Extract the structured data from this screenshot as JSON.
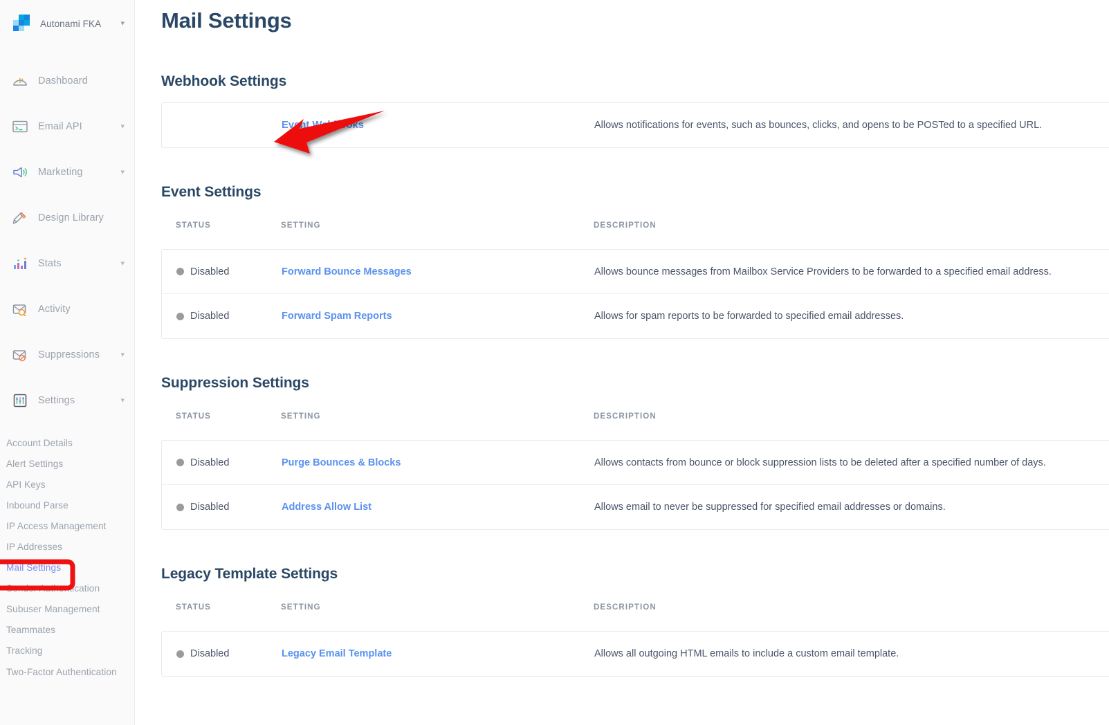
{
  "brand": {
    "name": "Autonami FKA",
    "caret": "chevron-down"
  },
  "sidebar": {
    "nav": [
      {
        "label": "Dashboard",
        "icon": "gauge-icon",
        "caret": false
      },
      {
        "label": "Email API",
        "icon": "terminal-icon",
        "caret": true
      },
      {
        "label": "Marketing",
        "icon": "megaphone-icon",
        "caret": true
      },
      {
        "label": "Design Library",
        "icon": "pencil-ruler-icon",
        "caret": false
      },
      {
        "label": "Stats",
        "icon": "bar-chart-icon",
        "caret": true
      },
      {
        "label": "Activity",
        "icon": "envelope-search-icon",
        "caret": false
      },
      {
        "label": "Suppressions",
        "icon": "envelope-block-icon",
        "caret": true
      },
      {
        "label": "Settings",
        "icon": "sliders-icon",
        "caret": true
      }
    ],
    "subnav": [
      {
        "label": "Account Details",
        "active": false
      },
      {
        "label": "Alert Settings",
        "active": false
      },
      {
        "label": "API Keys",
        "active": false
      },
      {
        "label": "Inbound Parse",
        "active": false
      },
      {
        "label": "IP Access Management",
        "active": false
      },
      {
        "label": "IP Addresses",
        "active": false
      },
      {
        "label": "Mail Settings",
        "active": true
      },
      {
        "label": "Sender Authentication",
        "active": false
      },
      {
        "label": "Subuser Management",
        "active": false
      },
      {
        "label": "Teammates",
        "active": false
      },
      {
        "label": "Tracking",
        "active": false
      },
      {
        "label": "Two-Factor Authentication",
        "active": false
      }
    ]
  },
  "page": {
    "title": "Mail Settings"
  },
  "columns": {
    "status": "STATUS",
    "setting": "SETTING",
    "description": "DESCRIPTION"
  },
  "sections": {
    "webhook": {
      "title": "Webhook Settings",
      "rows": [
        {
          "setting": "Event Webhooks",
          "description": "Allows notifications for events, such as bounces, clicks, and opens to be POSTed to a specified URL."
        }
      ]
    },
    "event": {
      "title": "Event Settings",
      "rows": [
        {
          "status": "Disabled",
          "setting": "Forward Bounce Messages",
          "description": "Allows bounce messages from Mailbox Service Providers to be forwarded to a specified email address."
        },
        {
          "status": "Disabled",
          "setting": "Forward Spam Reports",
          "description": "Allows for spam reports to be forwarded to specified email addresses."
        }
      ]
    },
    "suppression": {
      "title": "Suppression Settings",
      "rows": [
        {
          "status": "Disabled",
          "setting": "Purge Bounces & Blocks",
          "description": "Allows contacts from bounce or block suppression lists to be deleted after a specified number of days."
        },
        {
          "status": "Disabled",
          "setting": "Address Allow List",
          "description": "Allows email to never be suppressed for specified email addresses or domains."
        }
      ]
    },
    "legacy": {
      "title": "Legacy Template Settings",
      "rows": [
        {
          "status": "Disabled",
          "setting": "Legacy Email Template",
          "description": "Allows all outgoing HTML emails to include a custom email template."
        }
      ]
    }
  },
  "annotations": {
    "arrow": {
      "color": "#ee1111",
      "points_to": "Event Webhooks"
    },
    "highlight_box": {
      "color": "#ee1111",
      "target": "Mail Settings"
    }
  },
  "colors": {
    "link": "#5a92ee",
    "heading": "#2a4865",
    "muted": "#9aa3ae",
    "status_dot": "#9b9b9b",
    "annotation": "#ee1111"
  }
}
